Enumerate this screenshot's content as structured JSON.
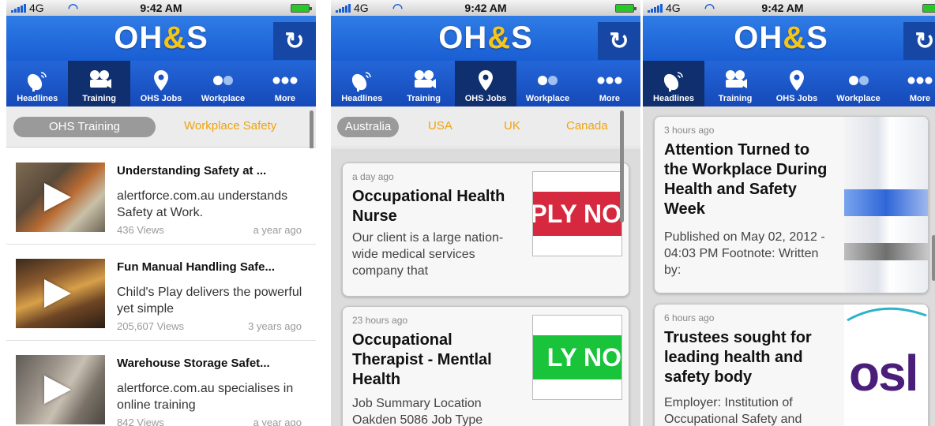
{
  "status": {
    "carrier": "4G",
    "time": "9:42 AM"
  },
  "app": {
    "logo_left": "OH",
    "logo_amp": "&",
    "logo_right": "S",
    "refresh_icon": "refresh-icon"
  },
  "tabs": [
    {
      "label": "Headlines",
      "icon": "satellite-icon"
    },
    {
      "label": "Training",
      "icon": "video-camera-icon"
    },
    {
      "label": "OHS Jobs",
      "icon": "location-pin-icon"
    },
    {
      "label": "Workplace",
      "icon": "dots-pair-icon"
    },
    {
      "label": "More",
      "icon": "more-dots-icon"
    }
  ],
  "screens": [
    {
      "active_tab": "Training",
      "segments": [
        "OHS Training",
        "Workplace Safety"
      ],
      "selected_segment": "OHS Training",
      "videos": [
        {
          "title": "Understanding Safety at ...",
          "desc": "alertforce.com.au understands Safety at Work.",
          "views": "436 Views",
          "age": "a year ago"
        },
        {
          "title": "Fun Manual Handling Safe...",
          "desc": "Child's Play delivers the powerful yet simple",
          "views": "205,607 Views",
          "age": "3 years ago"
        },
        {
          "title": "Warehouse Storage Safet...",
          "desc": "alertforce.com.au specialises in online training",
          "views": "842 Views",
          "age": "a year ago"
        }
      ]
    },
    {
      "active_tab": "OHS Jobs",
      "segments": [
        "Australia",
        "USA",
        "UK",
        "Canada"
      ],
      "selected_segment": "Australia",
      "jobs": [
        {
          "ago": "a day ago",
          "title": "Occupational Health Nurse",
          "desc": "Our client is a large nation-wide medical services company that",
          "image_text": "PPLY NO",
          "image_color": "#d6283e"
        },
        {
          "ago": "23 hours ago",
          "title": "Occupational Therapist - Mentlal Health",
          "desc": "Job Summary Location Oakden 5086 Job Type",
          "image_text": "LY NO",
          "image_color": "#19c43a"
        }
      ]
    },
    {
      "active_tab": "Headlines",
      "news": [
        {
          "ago": "3 hours ago",
          "title": "Attention Turned to the Workplace During Health and Safety Week",
          "desc": "Published on May 02, 2012 - 04:03 PM Footnote: Written by:"
        },
        {
          "ago": "6 hours ago",
          "title": "Trustees sought for leading health and safety body",
          "desc": "Employer: Institution of Occupational Safety and",
          "image_text": "osl",
          "image_color": "#4a1f7a"
        }
      ]
    }
  ]
}
